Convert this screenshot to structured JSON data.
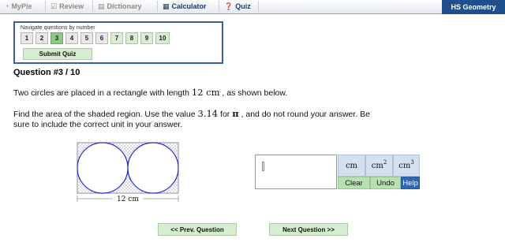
{
  "nav": {
    "tabs": [
      {
        "label": "MyPie",
        "icon": "pie-icon"
      },
      {
        "label": "Review",
        "icon": "check-icon"
      },
      {
        "label": "Dictionary",
        "icon": "book-icon"
      },
      {
        "label": "Calculator",
        "icon": "calculator-icon"
      },
      {
        "label": "Quiz",
        "icon": "quiz-icon"
      }
    ],
    "brand": "HS Geometry"
  },
  "navigator": {
    "label": "Navigate questions by number",
    "numbers": [
      "1",
      "2",
      "3",
      "4",
      "5",
      "6",
      "7",
      "8",
      "9",
      "10"
    ],
    "current": "3",
    "submit": "Submit Quiz"
  },
  "question": {
    "title": "Question #3 / 10",
    "line1_pre": "Two circles are placed in a rectangle with length ",
    "length_value": "12 cm",
    "line1_post": " , as shown below.",
    "line2_pre": "Find the area of the shaded region. Use the value ",
    "pi_value": "3.14",
    "line2_mid": " for ",
    "pi_symbol": "π",
    "line2_post": " , and do not round your answer. Be",
    "line3": "sure to include the correct unit in your answer.",
    "figure_label": "12 cm"
  },
  "answer": {
    "value": "",
    "units": [
      {
        "base": "cm",
        "exp": ""
      },
      {
        "base": "cm",
        "exp": "2"
      },
      {
        "base": "cm",
        "exp": "3"
      }
    ],
    "clear": "Clear",
    "undo": "Undo",
    "help": "Help"
  },
  "pager": {
    "prev": "<< Prev. Question",
    "next": "Next Question >>"
  },
  "colors": {
    "brand_bg": "#1f4f8f",
    "circle_stroke": "#2222dd",
    "shade_dots": "#4a4aa8",
    "button_green": "#d6edcf",
    "unit_blue": "#d4dff0",
    "help_blue": "#2f66b3"
  }
}
